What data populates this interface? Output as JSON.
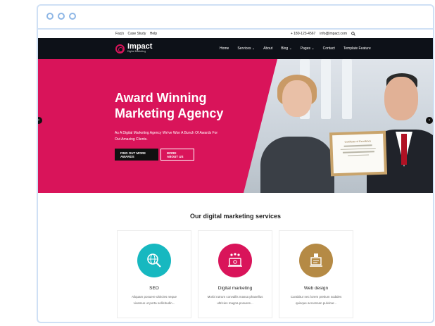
{
  "topbar": {
    "links": [
      "Faq's",
      "Case Study",
      "Help"
    ],
    "phone": "+ 180-123-4567",
    "email": "info@impact.com"
  },
  "nav": {
    "logo_title": "Impact",
    "logo_sub": "Digital Marketing",
    "menu": [
      {
        "label": "Home",
        "has_dropdown": false
      },
      {
        "label": "Services",
        "has_dropdown": true
      },
      {
        "label": "About",
        "has_dropdown": false
      },
      {
        "label": "Blog",
        "has_dropdown": true
      },
      {
        "label": "Pages",
        "has_dropdown": true
      },
      {
        "label": "Contact",
        "has_dropdown": false
      },
      {
        "label": "Template Feature",
        "has_dropdown": false
      }
    ]
  },
  "hero": {
    "title": "Award Winning Marketing Agency",
    "text": "As A Digital Marketing Agency We've Won A Bunch Of Awards For Out Amazing Clients.",
    "primary_button": "FIND OUT MORE AWARDS",
    "secondary_button": "MORE ABOUT US",
    "certificate_title": "Certificate of Excellence",
    "accent_color": "#d9145a"
  },
  "services": {
    "title": "Our digital marketing services",
    "cards": [
      {
        "name": "SEO",
        "text": "Aliquam posuere ultricies neque vivamus ut porta sollicitudin...",
        "icon": "seo-globe-icon",
        "color": "#17b8c0"
      },
      {
        "name": "Digital marketing",
        "text": "Morbi rutrum convallis massa phasellus ultricies magna posuere...",
        "icon": "digital-marketing-icon",
        "color": "#d9145a"
      },
      {
        "name": "Web design",
        "text": "Curabitur nec lorem pretium sodales quisque accumsan pulvinar...",
        "icon": "web-design-icon",
        "color": "#b58a45"
      }
    ]
  }
}
